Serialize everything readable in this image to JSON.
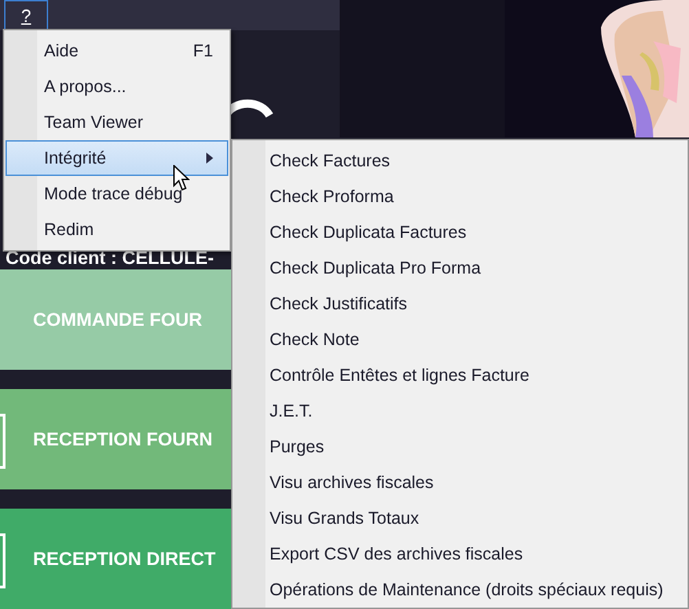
{
  "menubar": {
    "items": [
      {
        "label": "?",
        "selected": true
      }
    ]
  },
  "client_code": "Code client : CELLULE-",
  "tiles": [
    {
      "label": "COMMANDE FOUR",
      "color": "#96cba6",
      "framed": false
    },
    {
      "label": "RECEPTION FOURN",
      "color": "#72b97a",
      "framed": true
    },
    {
      "label": "RECEPTION DIRECT",
      "color": "#40ab68",
      "framed": true
    }
  ],
  "help_menu": {
    "items": [
      {
        "label": "Aide",
        "shortcut": "F1",
        "selected": false,
        "submenu": false
      },
      {
        "label": "A propos...",
        "selected": false,
        "submenu": false
      },
      {
        "label": "Team Viewer",
        "selected": false,
        "submenu": false
      },
      {
        "label": "Intégrité",
        "selected": true,
        "submenu": true
      },
      {
        "label": "Mode trace débug",
        "selected": false,
        "submenu": false
      },
      {
        "label": "Redim",
        "selected": false,
        "submenu": false
      }
    ]
  },
  "integrity_submenu": {
    "items": [
      "Check Factures",
      "Check Proforma",
      "Check Duplicata Factures",
      "Check Duplicata Pro Forma",
      "Check Justificatifs",
      "Check Note",
      "Contrôle Entêtes et lignes Facture",
      "J.E.T.",
      "Purges",
      "Visu archives fiscales",
      "Visu Grands Totaux",
      "Export CSV des archives fiscales",
      "Opérations de Maintenance (droits spéciaux requis)"
    ]
  }
}
